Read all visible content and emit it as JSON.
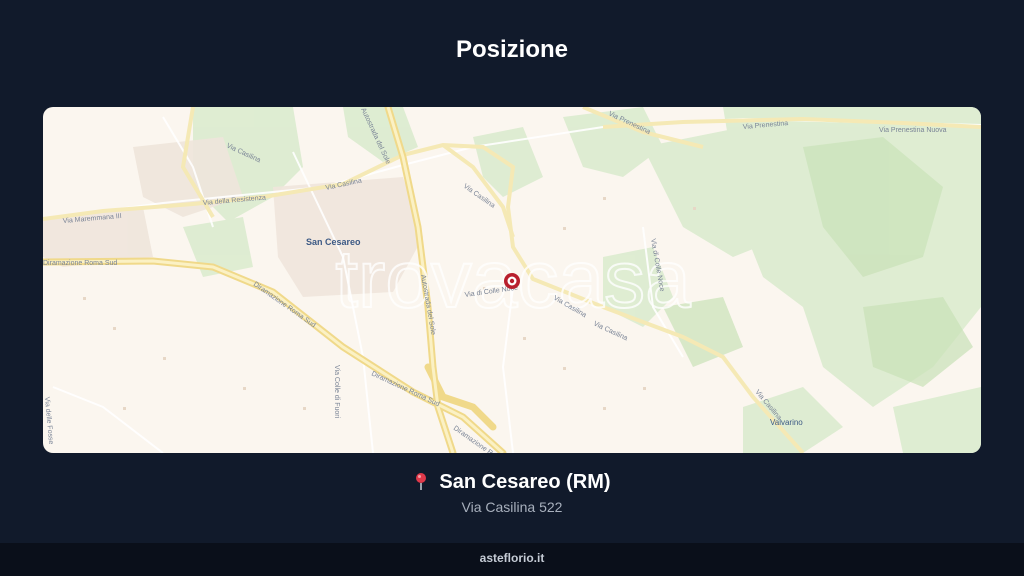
{
  "header": {
    "title": "Posizione"
  },
  "map": {
    "watermark": "trovacasa",
    "town_labels": [
      "San Cesareo",
      "Valvarino"
    ],
    "road_labels": [
      "Via Casilina",
      "Via Casilina",
      "Via Casilina",
      "Via Casilina",
      "Via Casilina",
      "Via Casilina",
      "Via Maremmana III",
      "Via della Resistenza",
      "Diramazione Roma Sud",
      "Diramazione Roma Sud",
      "Diramazione Roma Sud",
      "Diramazione Roma Sud",
      "Autostrada del Sole",
      "Autostrada del Sole",
      "Via Prenestina",
      "Via Prenestina",
      "Via Prenestina Nuova",
      "Via di Colle Noce",
      "Via delle Fosse",
      "Via Colle di Fuori",
      "Via di Colle Noce"
    ],
    "marker_icon": "location-marker-icon"
  },
  "location": {
    "icon": "pushpin-icon",
    "name": "San Cesareo (RM)",
    "address": "Via Casilina 522"
  },
  "footer": {
    "brand": "asteflorio.it"
  }
}
